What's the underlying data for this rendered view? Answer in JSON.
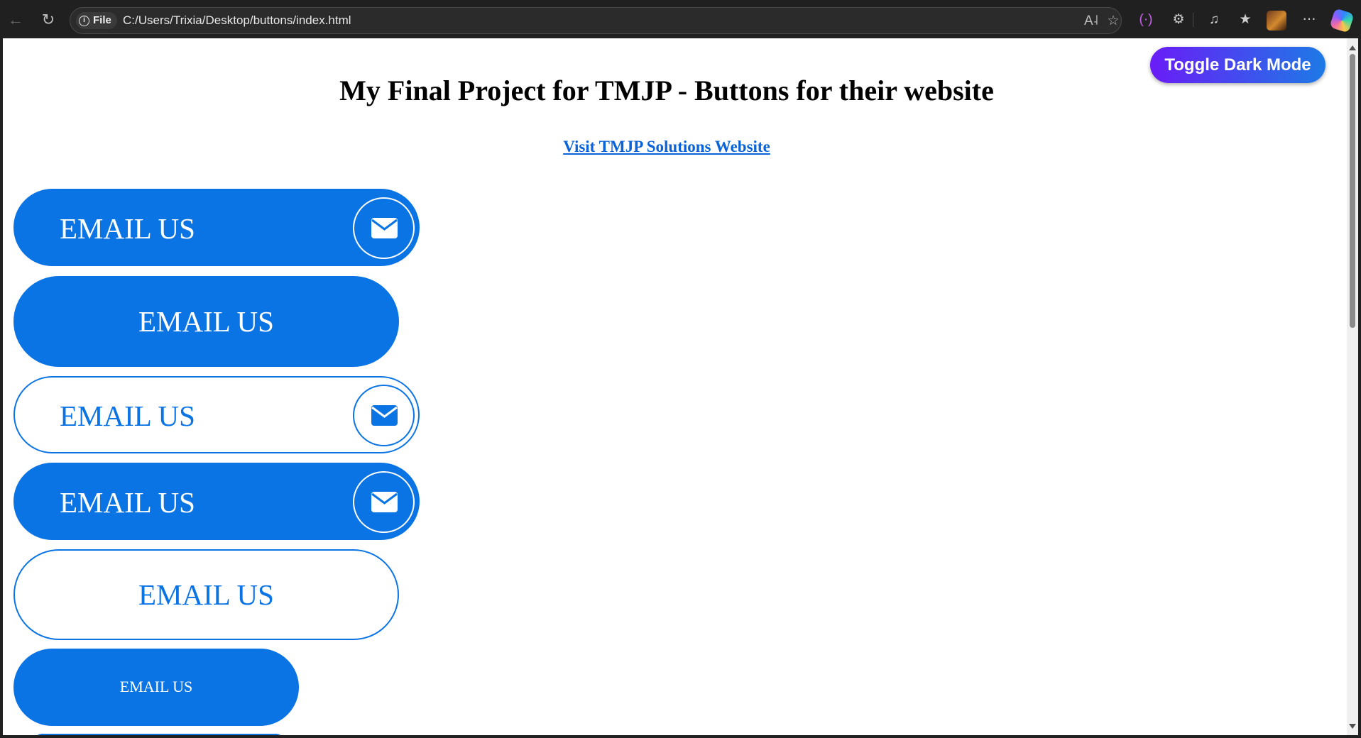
{
  "browser": {
    "site_info_label": "File",
    "url": "C:/Users/Trixia/Desktop/buttons/index.html"
  },
  "page": {
    "title": "My Final Project for TMJP - Buttons for their website",
    "link_text": "Visit TMJP Solutions Website",
    "toggle_label": "Toggle Dark Mode",
    "buttons": [
      {
        "label": "EMAIL US",
        "style": "filled",
        "icon": "envelope-icon"
      },
      {
        "label": "EMAIL US",
        "style": "filled",
        "icon": null
      },
      {
        "label": "EMAIL US",
        "style": "outline",
        "icon": "envelope-icon"
      },
      {
        "label": "EMAIL US",
        "style": "filled",
        "icon": "envelope-icon"
      },
      {
        "label": "EMAIL US",
        "style": "outline",
        "icon": null
      },
      {
        "label": "EMAIL US",
        "style": "filled-small",
        "icon": null
      }
    ]
  },
  "colors": {
    "primary": "#0a74e5",
    "toggle_gradient_start": "#6a1cf7",
    "toggle_gradient_end": "#1d7ae6",
    "link": "#0a63d8"
  }
}
